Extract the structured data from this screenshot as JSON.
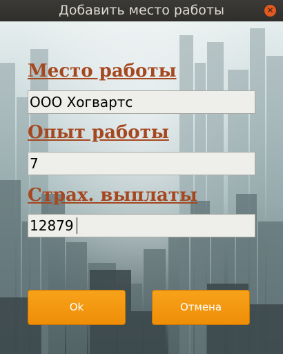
{
  "window": {
    "title": "Добавить место работы",
    "close_icon": "close-icon"
  },
  "form": {
    "workplace_label": "Место работы",
    "workplace_value": "ООО Хогвартс",
    "experience_label": "Опыт работы",
    "experience_value": "7",
    "insurance_label": "Страх. выплаты",
    "insurance_value": "12879"
  },
  "buttons": {
    "ok_label": "Ok",
    "cancel_label": "Отмена"
  },
  "colors": {
    "label": "#a5471f",
    "button": "#f39a12",
    "titlebar": "#35342f"
  }
}
